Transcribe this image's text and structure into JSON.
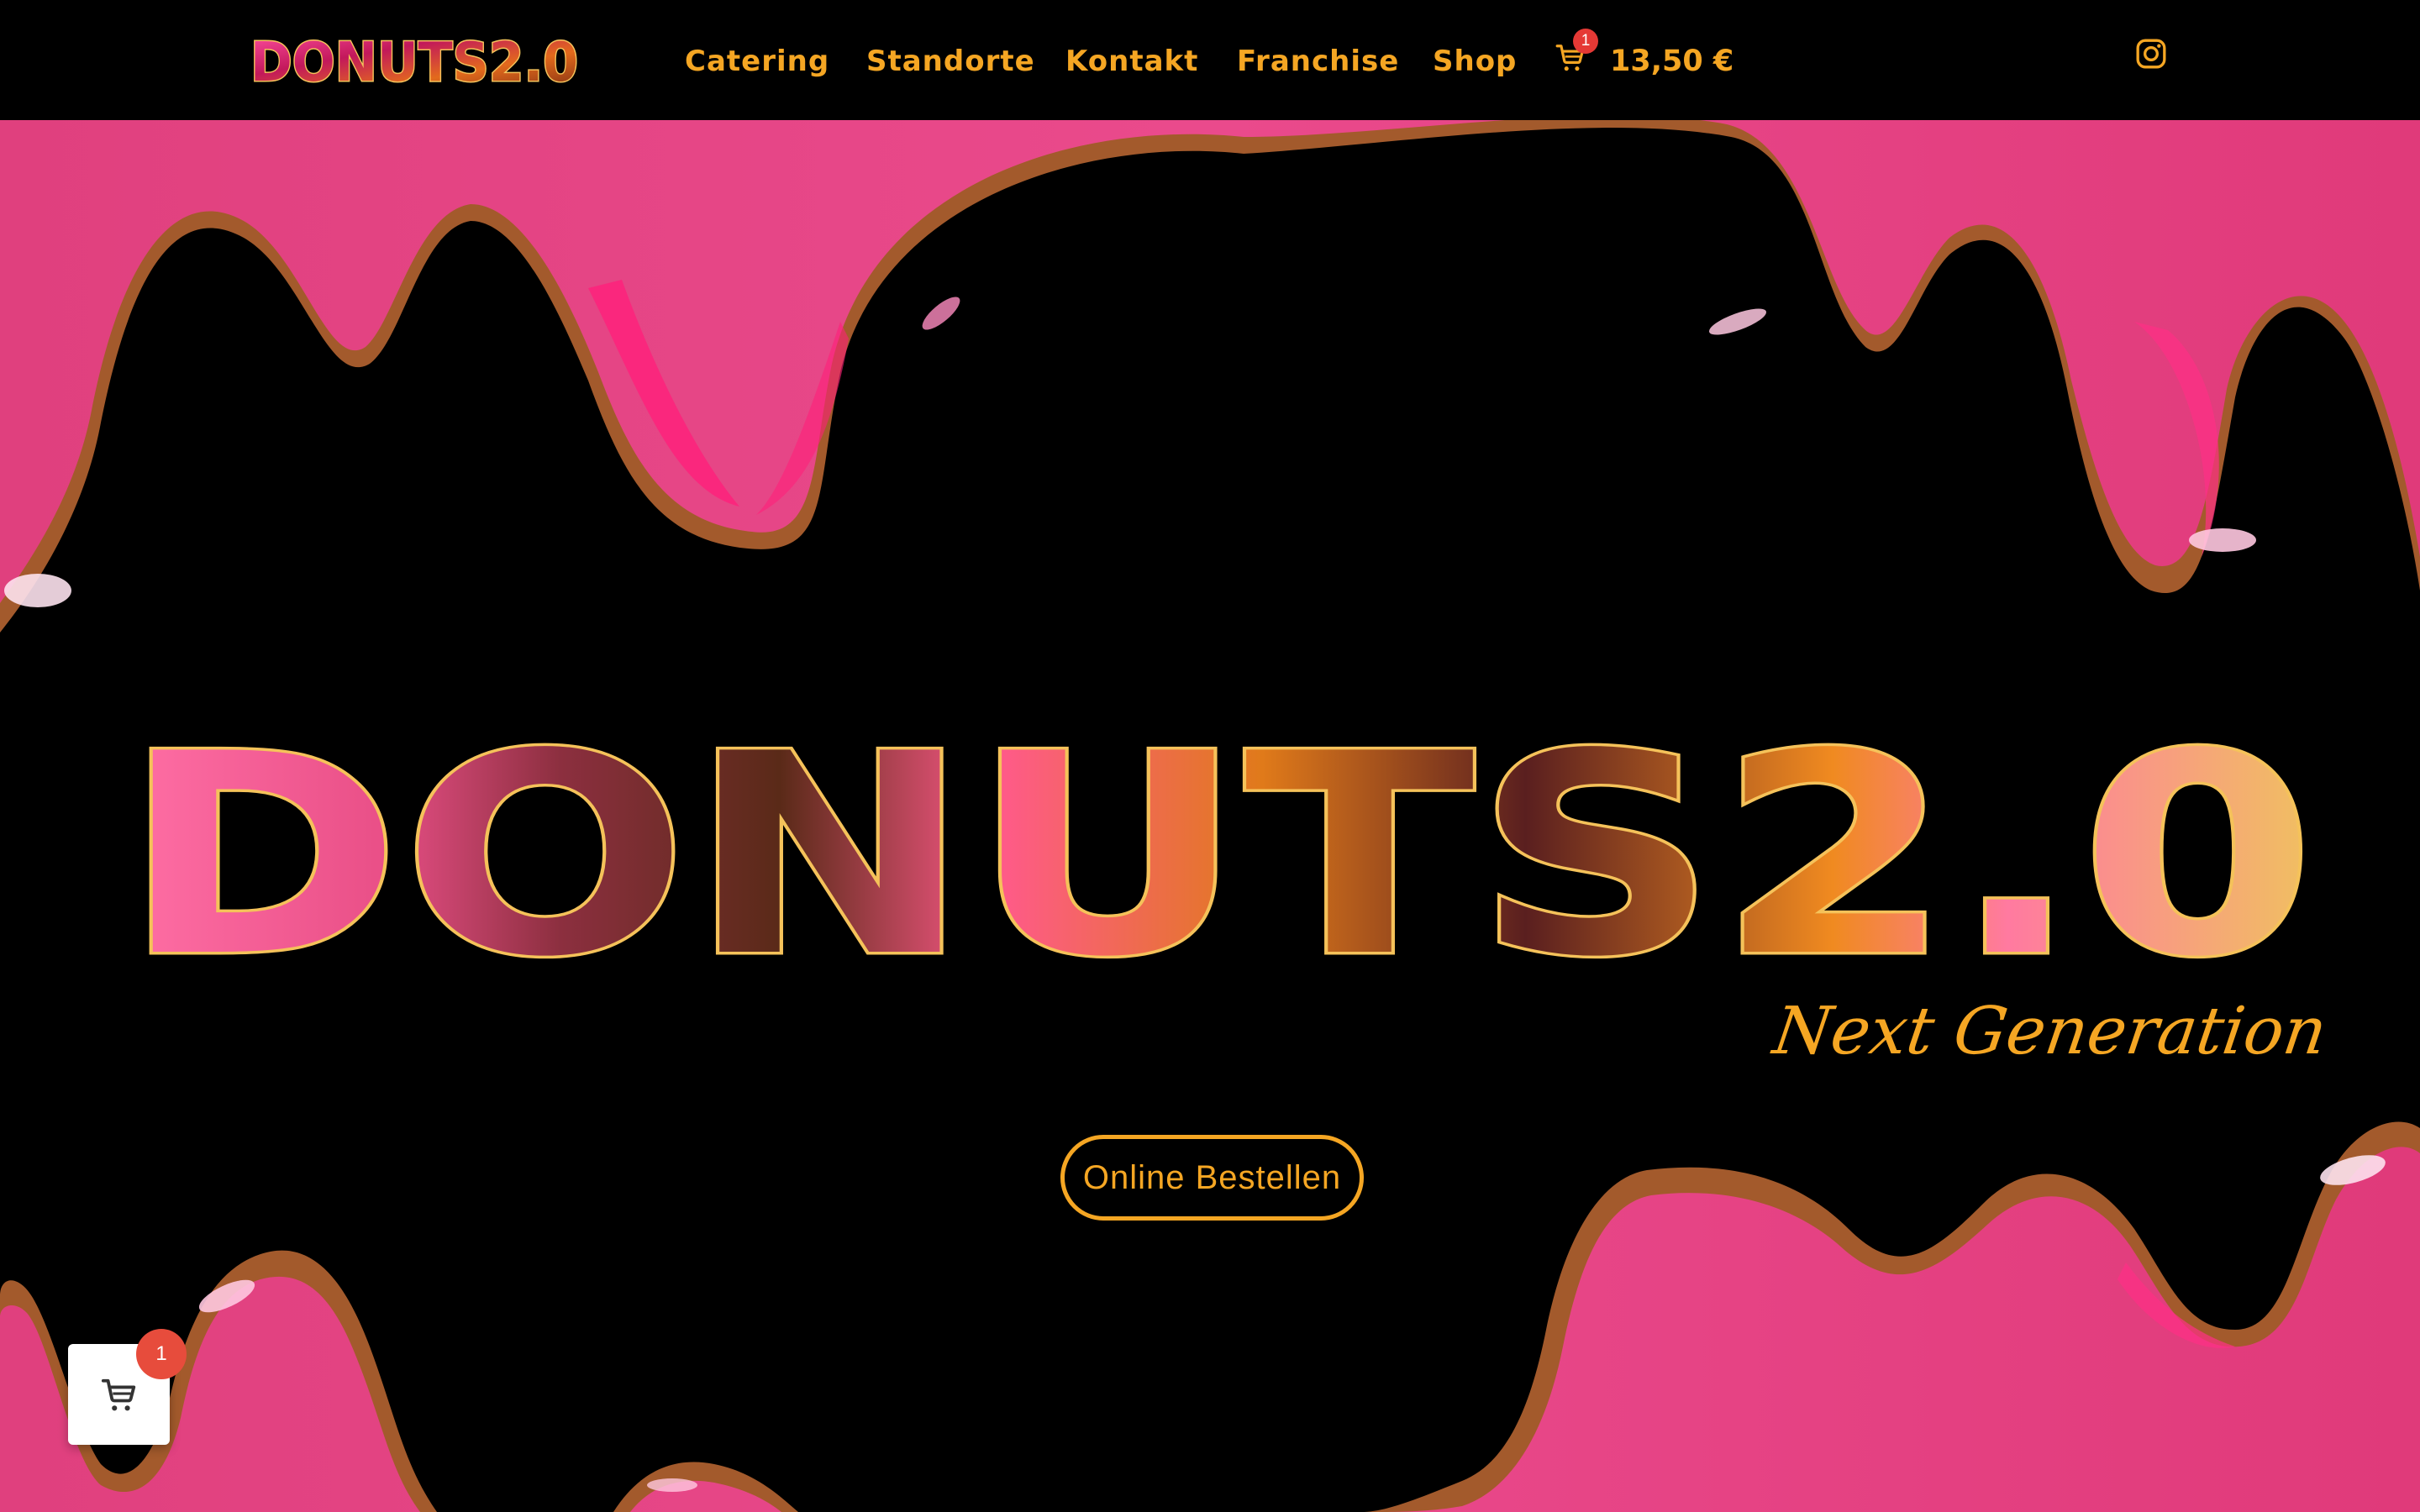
{
  "brand": {
    "logo_text": "DONUTS2.0",
    "colors": {
      "accent": "#f5a623",
      "pink": "#e8357a",
      "pink_dark": "#d81b60",
      "crust": "#a0592e",
      "badge": "#e53935"
    }
  },
  "nav": {
    "items": [
      {
        "label": "Catering"
      },
      {
        "label": "Standorte"
      },
      {
        "label": "Kontakt"
      },
      {
        "label": "Franchise"
      },
      {
        "label": "Shop"
      }
    ],
    "cart": {
      "count": "1",
      "amount": "13,50 €",
      "icon": "cart-icon"
    },
    "social": {
      "icon": "instagram-icon"
    }
  },
  "hero": {
    "title": "DONUTS2.0",
    "tagline": "Next Generation",
    "cta_label": "Online Bestellen"
  },
  "floating_cart": {
    "count": "1",
    "icon": "cart-icon"
  }
}
